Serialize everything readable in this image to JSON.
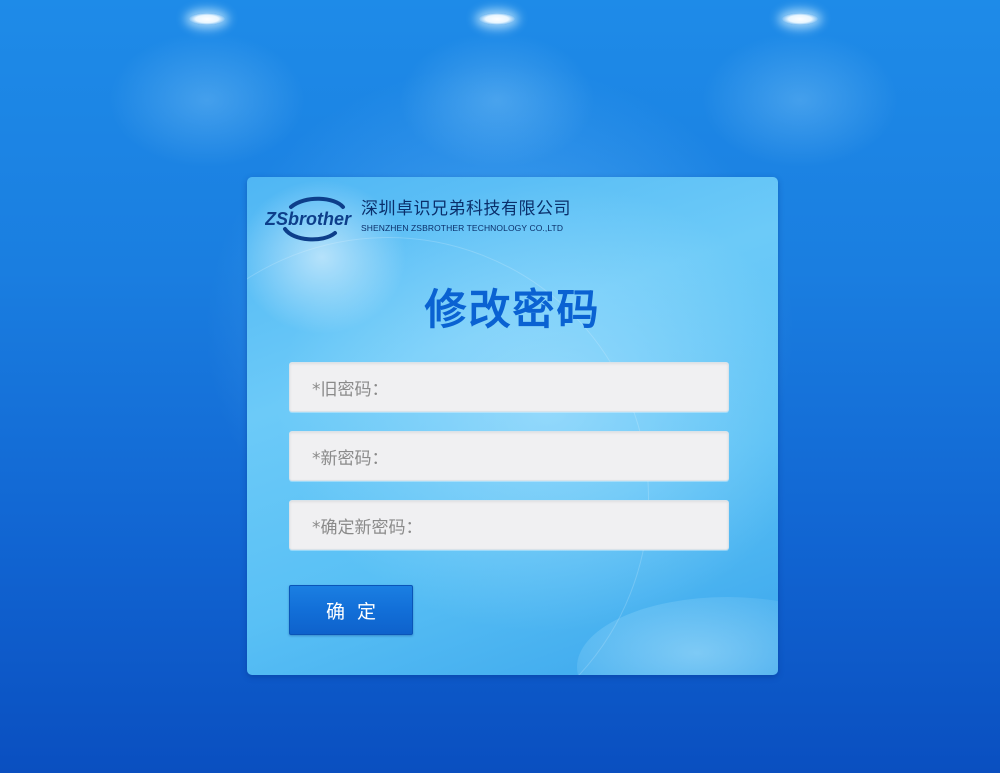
{
  "company": {
    "logo_text": "ZSbrother",
    "name_cn": "深圳卓识兄弟科技有限公司",
    "name_en": "SHENZHEN ZSBROTHER TECHNOLOGY CO.,LTD"
  },
  "page_title": "修改密码",
  "form": {
    "old_password_label": "*旧密码：",
    "new_password_label": "*新密码：",
    "confirm_password_label": "*确定新密码：",
    "submit_label": "确定"
  },
  "colors": {
    "background": "#1a7ee0",
    "title": "#0a62d2",
    "button": "#126fd8"
  }
}
